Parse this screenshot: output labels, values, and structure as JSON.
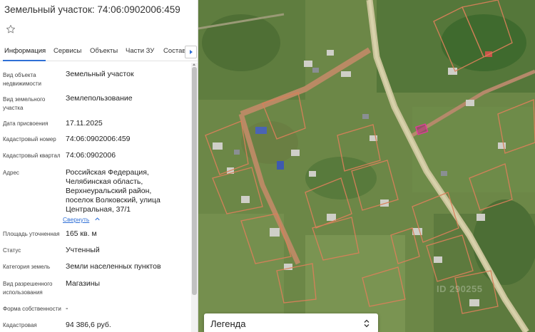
{
  "header": {
    "title": "Земельный участок: 74:06:0902006:459"
  },
  "tabs": [
    {
      "label": "Информация",
      "active": true
    },
    {
      "label": "Сервисы"
    },
    {
      "label": "Объекты"
    },
    {
      "label": "Части ЗУ"
    },
    {
      "label": "Состав"
    }
  ],
  "fields": [
    {
      "label": "Вид объекта недвижимости",
      "value": "Земельный участок"
    },
    {
      "label": "Вид земельного участка",
      "value": "Землепользование"
    },
    {
      "label": "Дата присвоения",
      "value": "17.11.2025"
    },
    {
      "label": "Кадастровый номер",
      "value": "74:06:0902006:459"
    },
    {
      "label": "Кадастровый квартал",
      "value": "74:06:0902006"
    },
    {
      "label": "Адрес",
      "value": "Российская Федерация, Челябинская область, Верхнеуральский район, поселок Волковский, улица Центральная, 37/1"
    },
    {
      "label": "Площадь уточненная",
      "value": "165 кв. м"
    },
    {
      "label": "Статус",
      "value": "Учтенный"
    },
    {
      "label": "Категория земель",
      "value": "Земли населенных пунктов"
    },
    {
      "label": "Вид разрешенного использования",
      "value": "Магазины"
    },
    {
      "label": "Форма собственности",
      "value": "-"
    },
    {
      "label": "Кадастровая",
      "value": "94 386,6 руб."
    }
  ],
  "address_toggle": "Свернуть",
  "legend": {
    "label": "Легенда"
  },
  "watermark": "ID 290255",
  "colors": {
    "accent": "#2f6fd6",
    "parcel_border": "#d9805a",
    "selected_parcel": "#b0287a"
  }
}
